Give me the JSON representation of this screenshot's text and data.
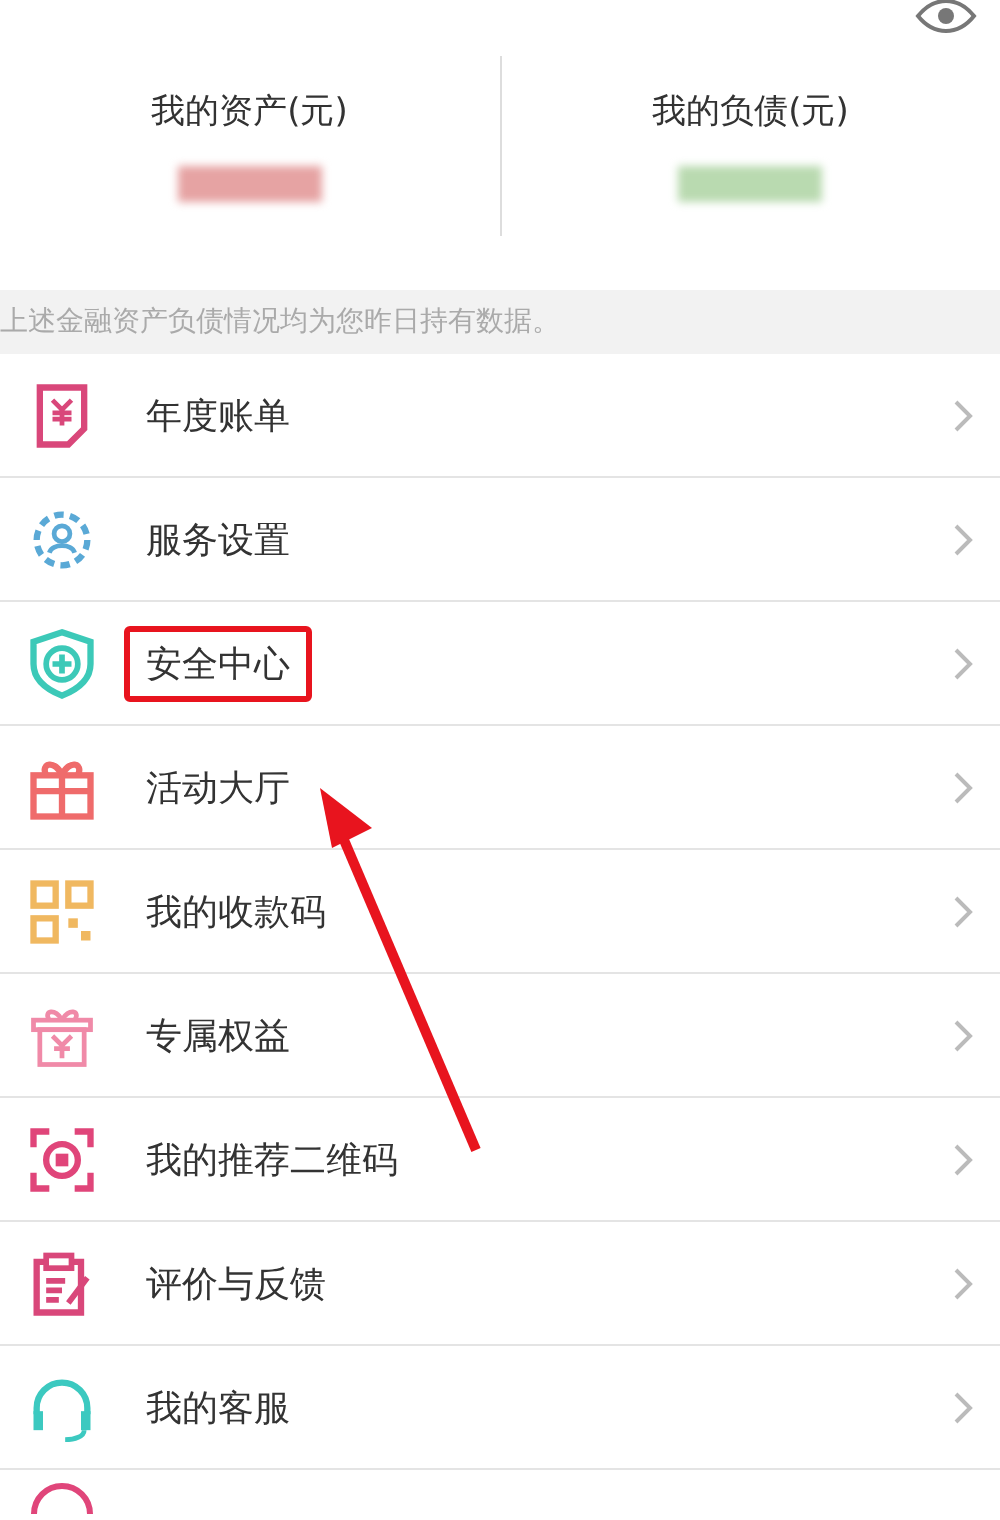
{
  "summary": [
    {
      "label": "我的资产(元)",
      "color": "#e6a3a3"
    },
    {
      "label": "我的负债(元)",
      "color": "#b9dab0"
    }
  ],
  "notice": "上述金融资产负债情况均为您昨日持有数据。",
  "menu": [
    {
      "label": "年度账单",
      "kind": "bill",
      "color": "#d9477a",
      "highlighted": false
    },
    {
      "label": "服务设置",
      "kind": "gear",
      "color": "#5aa9d6",
      "highlighted": false
    },
    {
      "label": "安全中心",
      "kind": "shield",
      "color": "#3cc9b8",
      "highlighted": true
    },
    {
      "label": "活动大厅",
      "kind": "gift",
      "color": "#ef6b6b",
      "highlighted": false
    },
    {
      "label": "我的收款码",
      "kind": "qr",
      "color": "#f0b860",
      "highlighted": false
    },
    {
      "label": "专属权益",
      "kind": "giftbox",
      "color": "#f08aa8",
      "highlighted": false
    },
    {
      "label": "我的推荐二维码",
      "kind": "scan",
      "color": "#e0457a",
      "highlighted": false
    },
    {
      "label": "评价与反馈",
      "kind": "clipboard",
      "color": "#d9477a",
      "highlighted": false
    },
    {
      "label": "我的客服",
      "kind": "headset",
      "color": "#3cc9c0",
      "highlighted": false
    }
  ]
}
